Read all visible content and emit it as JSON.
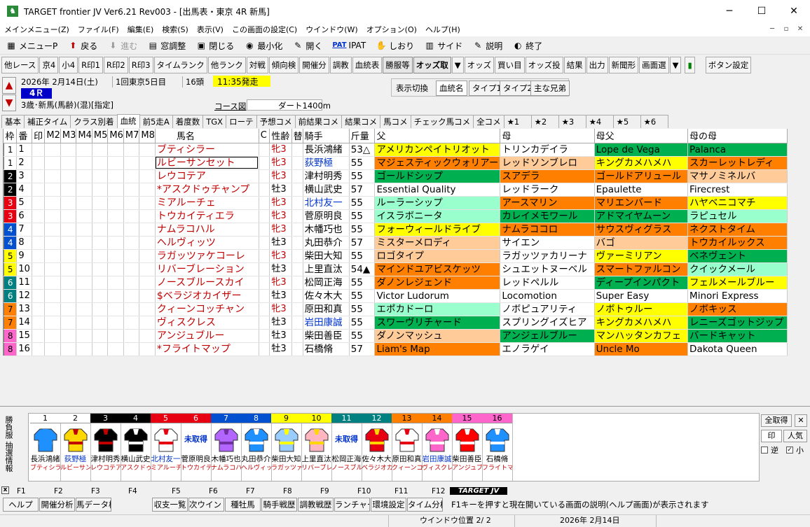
{
  "window": {
    "title": "TARGET frontier JV  Ver6.21  Rev003 - [出馬表・東京 4R 新馬]",
    "min": "─",
    "max": "☐",
    "close": "✕"
  },
  "menu": [
    "メインメニュー(Z)",
    "ファイル(F)",
    "編集(E)",
    "検索(S)",
    "表示(V)",
    "この画面の設定(C)",
    "ウインドウ(W)",
    "オプション(O)",
    "ヘルプ(H)"
  ],
  "mdi": [
    "─",
    "▫",
    "✕"
  ],
  "toolbar1": [
    {
      "label": "メニューP",
      "icon": "menu-icon",
      "sym": "▦"
    },
    {
      "label": "戻る",
      "icon": "back-arrow-icon",
      "sym": "⬆"
    },
    {
      "label": "進む",
      "icon": "forward-arrow-icon",
      "sym": "⬇",
      "disabled": true
    },
    {
      "label": "窓調整",
      "icon": "window-adjust-icon",
      "sym": "▤"
    },
    {
      "label": "閉じる",
      "icon": "close-window-icon",
      "sym": "▣"
    },
    {
      "label": "最小化",
      "icon": "minimize-icon",
      "sym": "◉"
    },
    {
      "label": "開く",
      "icon": "open-icon",
      "sym": "✎"
    },
    {
      "label": "IPAT",
      "icon": "pat-icon",
      "sym": "PAT"
    },
    {
      "label": "しおり",
      "icon": "bookmark-icon",
      "sym": "✋"
    },
    {
      "label": "サイド",
      "icon": "side-icon",
      "sym": "▥"
    },
    {
      "label": "説明",
      "icon": "help-doc-icon",
      "sym": "✎"
    },
    {
      "label": "終了",
      "icon": "exit-icon",
      "sym": "◐"
    }
  ],
  "toolbar2": [
    "他レース",
    "京4",
    "小4",
    "R印1",
    "R印2",
    "R印3",
    "タイムランク",
    "他ランク",
    "対戦",
    "傾向検",
    "開催分",
    "調教",
    "血統表",
    "勝服等",
    "オッズ取",
    "▼",
    "オッズ",
    "買い目",
    "オッズ投",
    "結果",
    "出力",
    "新聞形",
    "画面選",
    "▼",
    "▮",
    "ボタン設定"
  ],
  "race": {
    "date": "2026年 2月14日(土)",
    "kai": "1回東京5日目",
    "heads": "16頭",
    "time": "11:35発走",
    "raceno": "4Ｒ",
    "cond": "3歳･新馬(馬齢)(混)[指定]",
    "course_btn": "コース図",
    "course": "ダート1400m"
  },
  "switch": {
    "label": "表示切換",
    "buttons": [
      "血統名",
      "タイプ1",
      "タイプ2",
      "主な兄弟"
    ]
  },
  "tabs": [
    "基本",
    "補正タイム",
    "クラス別着",
    "血統",
    "前5走A",
    "着度数",
    "TGX",
    "ローテ",
    "予想コメ",
    "前結果コメ",
    "結果コメ",
    "馬コメ",
    "チェック馬コメ",
    "全コメ",
    "★1",
    "★2",
    "★3",
    "★4",
    "★5",
    "★6"
  ],
  "columns": [
    "枠",
    "番",
    "印",
    "M2",
    "M3",
    "M4",
    "M5",
    "M6",
    "M7",
    "M8",
    "馬名",
    "C",
    "性齢",
    "替",
    "騎手",
    "斤量",
    "父",
    "母",
    "母父",
    "母の母"
  ],
  "horses": [
    {
      "waku": "1",
      "no": "1",
      "name": "ブティシラー",
      "sex": "牝3",
      "f": true,
      "jockey": "長浜鴻緒",
      "jb": false,
      "wt": "53△",
      "sire": "アメリカンペイトリオット",
      "sc": "#ffff00",
      "dam": "トリンカデイラ",
      "dc": "#ffffff",
      "bms": "Lope de Vega",
      "bc": "#00b050",
      "bmd": "Palanca",
      "mc": "#00b050"
    },
    {
      "waku": "1",
      "no": "2",
      "name": "ルビーサンセット",
      "sex": "牝3",
      "f": true,
      "jockey": "荻野極",
      "jb": true,
      "wt": "55",
      "sire": "マジェスティックウォリアー",
      "sc": "#ff8000",
      "dam": "レッドソンブレロ",
      "dc": "#ffcc99",
      "bms": "キングカメハメハ",
      "bc": "#ffff00",
      "bmd": "スカーレットレディ",
      "mc": "#ff8000",
      "sel": true
    },
    {
      "waku": "2",
      "no": "3",
      "name": "レウコテア",
      "sex": "牝3",
      "f": true,
      "jockey": "津村明秀",
      "jb": false,
      "wt": "55",
      "sire": "ゴールドシップ",
      "sc": "#00b050",
      "dam": "スアデラ",
      "dc": "#ff8000",
      "bms": "ゴールドアリュール",
      "bc": "#ff8000",
      "bmd": "マサノミネルバ",
      "mc": "#ffcc99"
    },
    {
      "waku": "2",
      "no": "4",
      "name": "*アスクドゥチャンプ",
      "sex": "牡3",
      "f": false,
      "jockey": "横山武史",
      "jb": false,
      "wt": "57",
      "sire": "Essential Quality",
      "sc": "#ffffff",
      "dam": "レッドラーク",
      "dc": "#ffffff",
      "bms": "Epaulette",
      "bc": "#ffffff",
      "bmd": "Firecrest",
      "mc": "#ffffff"
    },
    {
      "waku": "3",
      "no": "5",
      "name": "ミアルーチェ",
      "sex": "牝3",
      "f": true,
      "jockey": "北村友一",
      "jb": true,
      "wt": "55",
      "sire": "ルーラーシップ",
      "sc": "#99ffcc",
      "dam": "アースマリン",
      "dc": "#ff8000",
      "bms": "マリエンバード",
      "bc": "#ff8000",
      "bmd": "ハヤベニコマチ",
      "mc": "#ffff00"
    },
    {
      "waku": "3",
      "no": "6",
      "name": "トウカイティエラ",
      "sex": "牝3",
      "f": true,
      "jockey": "菅原明良",
      "jb": false,
      "wt": "55",
      "sire": "イスラボニータ",
      "sc": "#99ffcc",
      "dam": "カレイメモワール",
      "dc": "#00b050",
      "bms": "アドマイヤムーン",
      "bc": "#00b050",
      "bmd": "ラピュセル",
      "mc": "#99ffcc"
    },
    {
      "waku": "4",
      "no": "7",
      "name": "ナムラコハル",
      "sex": "牝3",
      "f": true,
      "jockey": "木幡巧也",
      "jb": false,
      "wt": "55",
      "sire": "フォーウィールドライブ",
      "sc": "#ffff00",
      "dam": "ナムラココロ",
      "dc": "#ff8000",
      "bms": "サウスヴィグラス",
      "bc": "#ff8000",
      "bmd": "ネクストタイム",
      "mc": "#ff8000"
    },
    {
      "waku": "4",
      "no": "8",
      "name": "ヘルヴィッツ",
      "sex": "牡3",
      "f": false,
      "jockey": "丸田恭介",
      "jb": false,
      "wt": "57",
      "sire": "ミスターメロディ",
      "sc": "#ffcc99",
      "dam": "サイエン",
      "dc": "#ffffff",
      "bms": "バゴ",
      "bc": "#ffcc99",
      "bmd": "トウカイルックス",
      "mc": "#ff8000"
    },
    {
      "waku": "5",
      "no": "9",
      "name": "ラガッツァケコーレ",
      "sex": "牝3",
      "f": true,
      "jockey": "柴田大知",
      "jb": false,
      "wt": "55",
      "sire": "ロゴタイプ",
      "sc": "#ffcc99",
      "dam": "ラガッツァカリーナ",
      "dc": "#ffffff",
      "bms": "ヴァーミリアン",
      "bc": "#ffff00",
      "bmd": "ベネヴェント",
      "mc": "#00b050"
    },
    {
      "waku": "5",
      "no": "10",
      "name": "リバーブレーション",
      "sex": "牡3",
      "f": false,
      "jockey": "上里直汰",
      "jb": false,
      "wt": "54▲",
      "sire": "マインドユアビスケッツ",
      "sc": "#ff8000",
      "dam": "シュエットヌーベル",
      "dc": "#ffffff",
      "bms": "スマートファルコン",
      "bc": "#ff8000",
      "bmd": "クイックメール",
      "mc": "#99ffcc"
    },
    {
      "waku": "6",
      "no": "11",
      "name": "ノースブルースカイ",
      "sex": "牝3",
      "f": true,
      "jockey": "松岡正海",
      "jb": false,
      "wt": "55",
      "sire": "ダノンレジェンド",
      "sc": "#ff8000",
      "dam": "レッドペルル",
      "dc": "#ffffff",
      "bms": "ディープインパクト",
      "bc": "#00b050",
      "bmd": "フェルメールブルー",
      "mc": "#ffff00"
    },
    {
      "waku": "6",
      "no": "12",
      "name": "$ベラジオカイザー",
      "sex": "牡3",
      "f": false,
      "jockey": "佐々木大",
      "jb": false,
      "wt": "55",
      "sire": "Victor Ludorum",
      "sc": "#ffffff",
      "dam": "Locomotion",
      "dc": "#ffffff",
      "bms": "Super Easy",
      "bc": "#ffffff",
      "bmd": "Minori Express",
      "mc": "#ffffff"
    },
    {
      "waku": "7",
      "no": "13",
      "name": "クィーンコッチャン",
      "sex": "牝3",
      "f": true,
      "jockey": "原田和真",
      "jb": false,
      "wt": "55",
      "sire": "エポカドーロ",
      "sc": "#99ffcc",
      "dam": "ノボピュアリティ",
      "dc": "#ffffff",
      "bms": "ノボトゥルー",
      "bc": "#ffff00",
      "bmd": "ノボキッス",
      "mc": "#ff8000"
    },
    {
      "waku": "7",
      "no": "14",
      "name": "ヴィスクレス",
      "sex": "牡3",
      "f": false,
      "jockey": "岩田康誠",
      "jb": true,
      "wt": "55",
      "sire": "スワーヴリチャード",
      "sc": "#00b050",
      "dam": "スプリングイズヒア",
      "dc": "#ffffff",
      "bms": "キングカメハメハ",
      "bc": "#ffff00",
      "bmd": "レニーズゴットジップ",
      "mc": "#00b050"
    },
    {
      "waku": "8",
      "no": "15",
      "name": "アンジュブルー",
      "sex": "牡3",
      "f": false,
      "jockey": "柴田善臣",
      "jb": false,
      "wt": "55",
      "sire": "ダノンマッシュ",
      "sc": "#ffcc99",
      "dam": "アンジェルブルー",
      "dc": "#00b050",
      "bms": "マンハッタンカフェ",
      "bc": "#ffff00",
      "bmd": "バードキャット",
      "mc": "#00b050"
    },
    {
      "waku": "8",
      "no": "16",
      "name": "*フライトマップ",
      "sex": "牡3",
      "f": false,
      "jockey": "石橋脩",
      "jb": false,
      "wt": "57",
      "sire": "Liam's Map",
      "sc": "#ff8000",
      "dam": "エノラゲイ",
      "dc": "#ffffff",
      "bms": "Uncle Mo",
      "bc": "#ff8000",
      "bmd": "Dakota Queen",
      "mc": "#ffffff"
    }
  ],
  "waku_colors": {
    "1": [
      "#ffffff",
      "#000000"
    ],
    "2": [
      "#000000",
      "#ffffff"
    ],
    "3": [
      "#e60012",
      "#ffffff"
    ],
    "4": [
      "#0050d0",
      "#ffffff"
    ],
    "5": [
      "#ffff00",
      "#000000"
    ],
    "6": [
      "#008080",
      "#ffffff"
    ],
    "7": [
      "#ff8000",
      "#000000"
    ],
    "8": [
      "#ff66cc",
      "#000000"
    ]
  },
  "bottom": {
    "side_label": "勝負服\n抽選情報",
    "silk_jockeys": [
      "長浜鴻緒",
      "荻野極",
      "津村明秀",
      "横山武史",
      "北村友一",
      "菅原明良",
      "木幡巧也",
      "丸田恭介",
      "柴田大知",
      "上里直汰",
      "松岡正海",
      "佐々木大",
      "原田和真",
      "岩田康誠",
      "柴田善臣",
      "石橋脩"
    ],
    "silk_horses": [
      "ブティシラー",
      "ルビーサンセット",
      "レウコテア",
      "アスクドゥチャンプ",
      "ミアルーチェ",
      "トウカイティエラ",
      "ナムラコハル",
      "ヘルヴィッツ",
      "ラガッツァケコーレ",
      "リバーブレーション",
      "ノースブルースカイ",
      "ベラジオカイザー",
      "クィーンコッチャン",
      "ヴィスクレス",
      "アンジュブルー",
      "フライトマップ"
    ],
    "unregistered": "未取得",
    "get_all": "全取得",
    "close": "✕",
    "mark": "印",
    "pop": "人気",
    "rev": "逆",
    "small": "小",
    "x": "x"
  },
  "fkeys": {
    "labels": [
      "F1",
      "F2",
      "F3",
      "F4",
      "F5",
      "F6",
      "F7",
      "F8",
      "F9",
      "F10",
      "F11",
      "F12"
    ],
    "logo": "TARGET JV",
    "buttons": [
      "ヘルプ",
      "開催分析",
      "馬データ検",
      "",
      "収支一覧",
      "次ウインドウ",
      "種牡馬",
      "騎手戦歴",
      "調教戦歴",
      "ランチャー",
      "環境設定",
      "タイム分析"
    ],
    "hint": "F1キーを押すと現在開いている画面の説明(ヘルプ画面)が表示されます"
  },
  "status": {
    "pos": "ウインドウ位置 2/ 2",
    "date": "2026年 2月14日"
  }
}
